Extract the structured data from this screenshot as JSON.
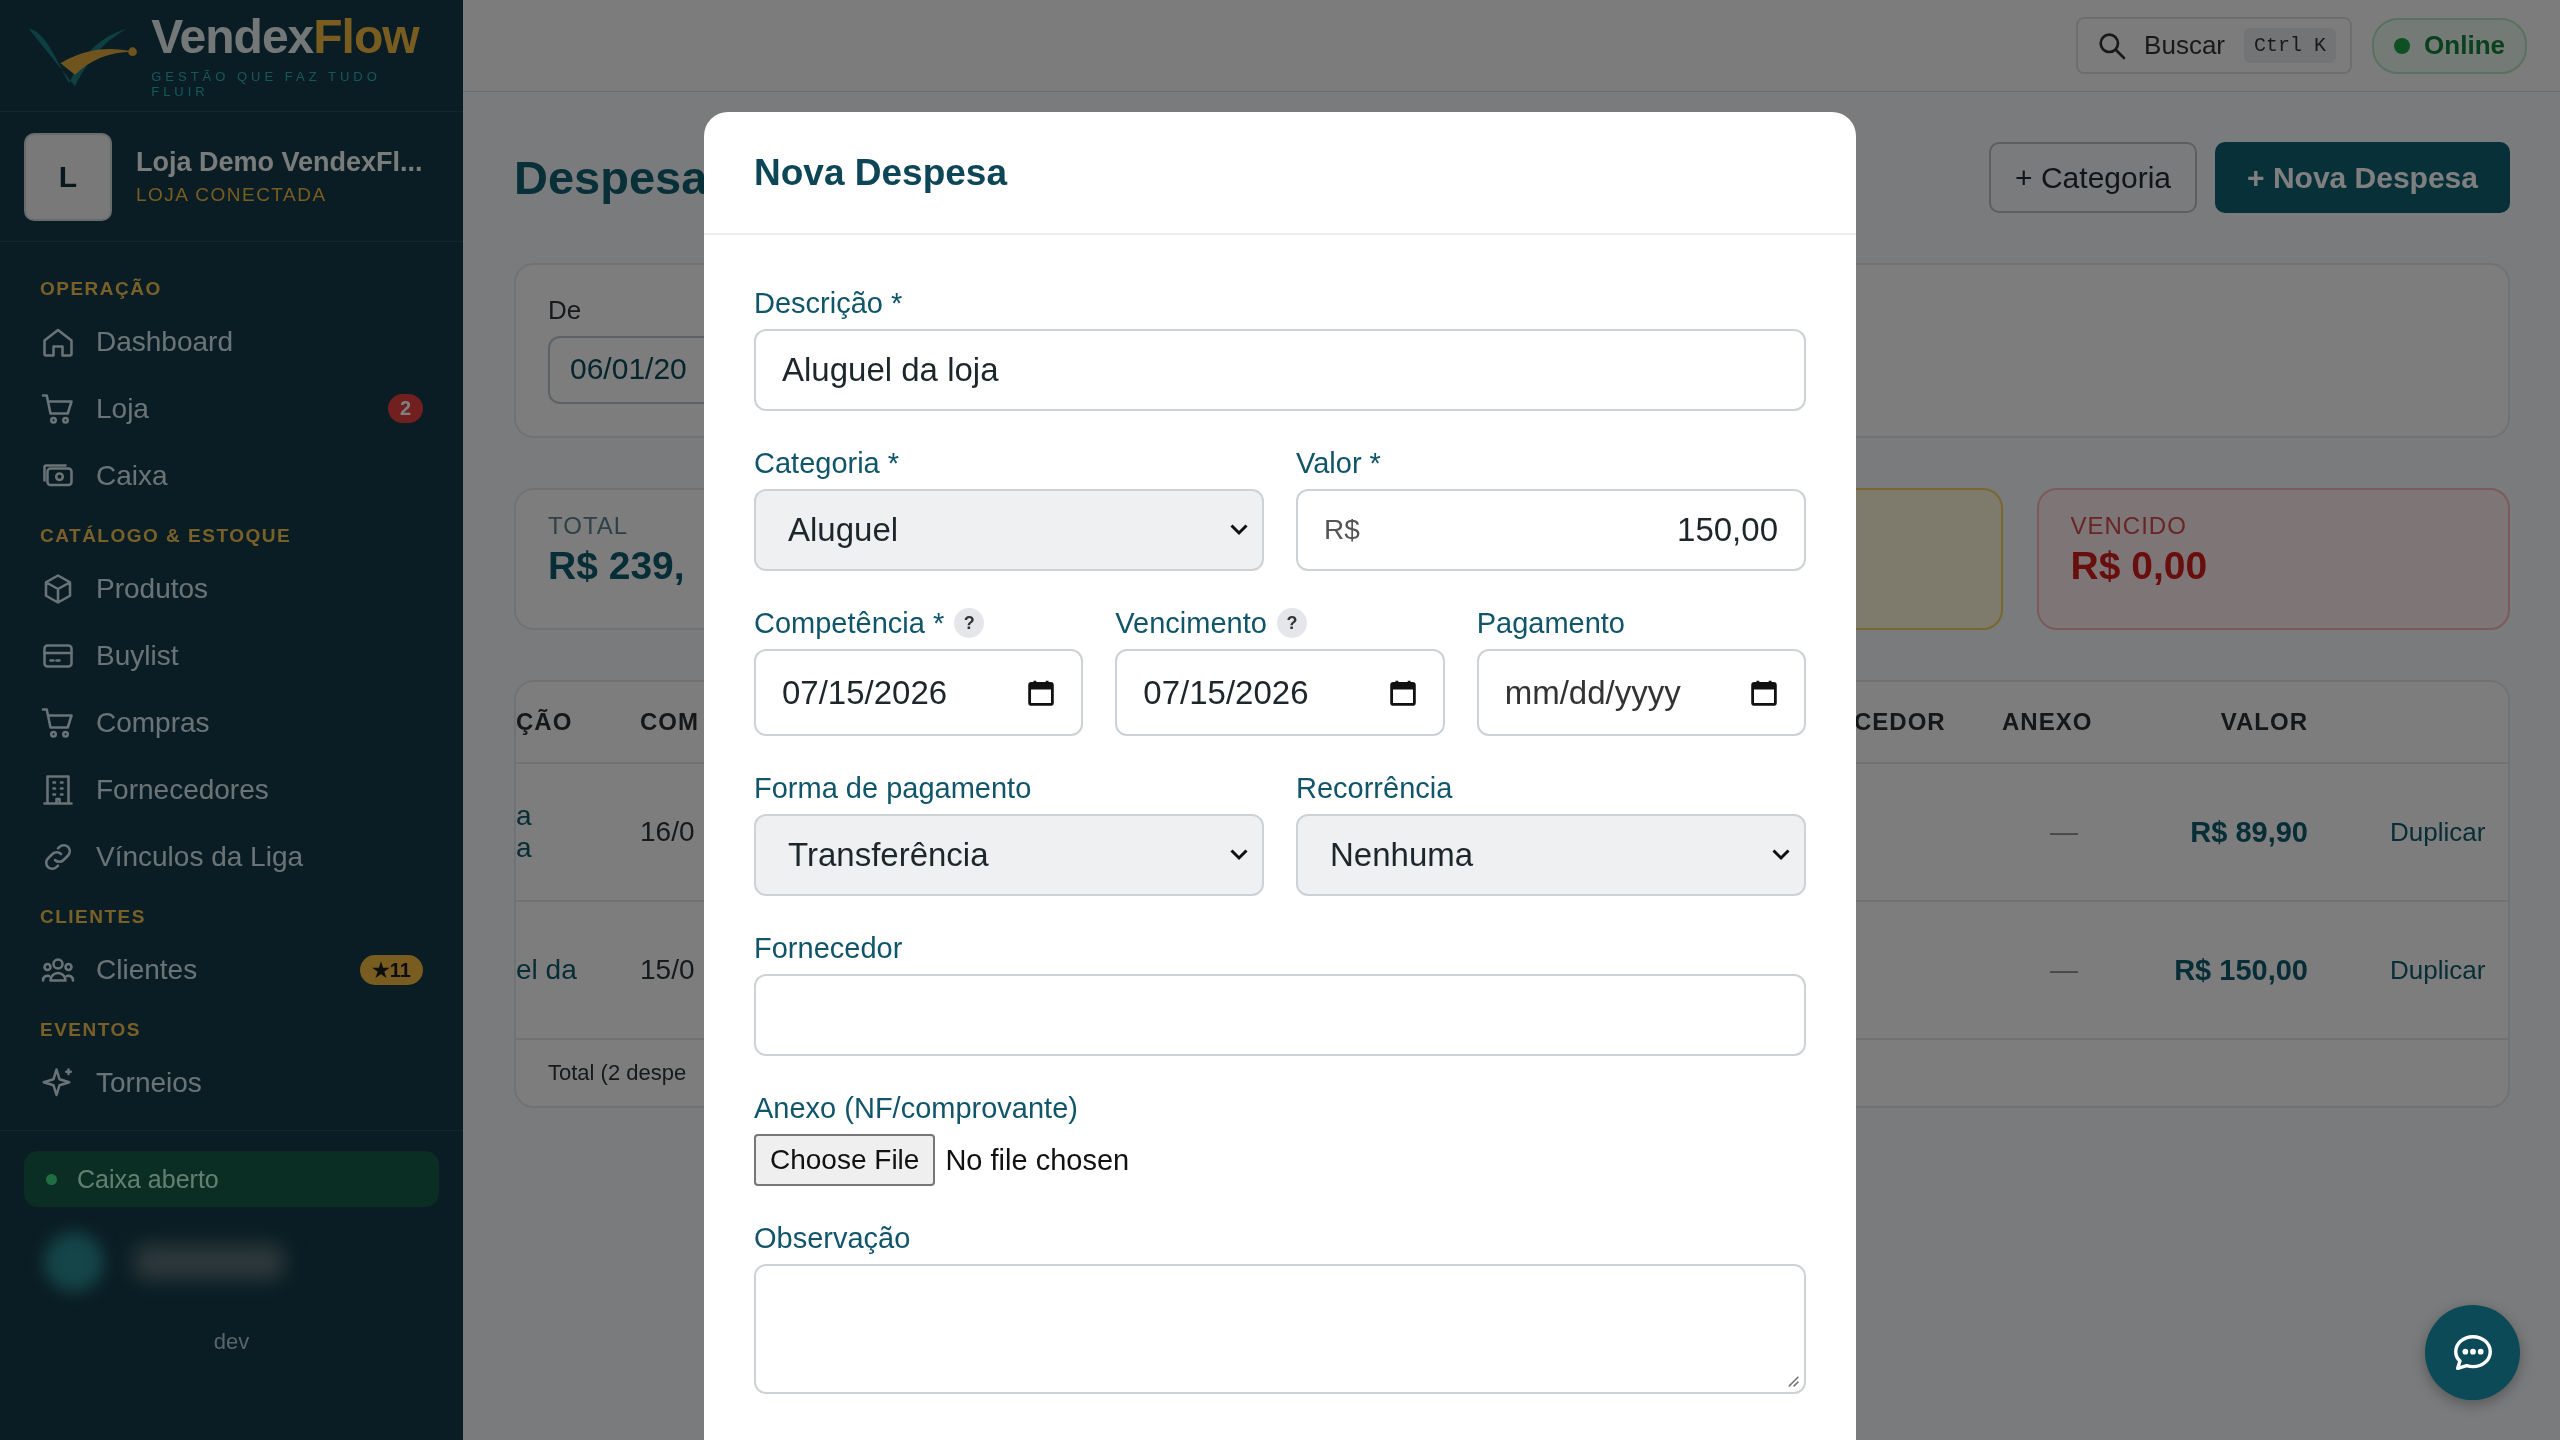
{
  "sidebar": {
    "brand": {
      "name": [
        "Vendex",
        "Flow"
      ],
      "tagline": "GESTÃO QUE FAZ TUDO FLUIR"
    },
    "store": {
      "initial": "L",
      "name": "Loja Demo VendexFl...",
      "status": "LOJA CONECTADA"
    },
    "sections": [
      {
        "title": "OPERAÇÃO",
        "items": [
          {
            "label": "Dashboard"
          },
          {
            "label": "Loja",
            "badge": "2",
            "kind": "alert"
          },
          {
            "label": "Caixa"
          }
        ]
      },
      {
        "title": "CATÁLOGO & ESTOQUE",
        "items": [
          {
            "label": "Produtos"
          },
          {
            "label": "Buylist"
          },
          {
            "label": "Compras"
          },
          {
            "label": "Fornecedores"
          },
          {
            "label": "Vínculos da Liga"
          }
        ]
      },
      {
        "title": "CLIENTES",
        "items": [
          {
            "label": "Clientes",
            "badge": "★11",
            "kind": "highlight"
          }
        ]
      },
      {
        "title": "EVENTOS",
        "items": [
          {
            "label": "Torneios"
          }
        ]
      }
    ],
    "cash_status": "Caixa aberto",
    "footer": "dev"
  },
  "topbar": {
    "search": {
      "placeholder": "Buscar",
      "shortcut": "Ctrl K"
    },
    "status": "Online"
  },
  "page": {
    "title": "Despesa",
    "actions": [
      {
        "label": "+ Categoria",
        "kind": "secondary"
      },
      {
        "label": "+ Nova Despesa",
        "kind": "primary"
      }
    ],
    "filter": {
      "label": "De",
      "value": "06/01/20"
    },
    "stats": [
      {
        "label": "TOTAL",
        "value": "R$ 239,",
        "kind": "neutral"
      },
      {
        "kind": "warning"
      },
      {
        "label": "VENCIDO",
        "value": "R$ 0,00",
        "kind": "danger"
      }
    ],
    "table": {
      "columns": [
        "ÇÃO",
        "COM",
        "CEDOR",
        "ANEXO",
        "VALOR"
      ],
      "rows": [
        {
          "description": "a\na",
          "date": "16/0",
          "attachment": "—",
          "value": "R$ 89,90",
          "action": "Duplicar"
        },
        {
          "description": "el da",
          "date": "15/0",
          "attachment": "—",
          "value": "R$ 150,00",
          "action": "Duplicar"
        }
      ],
      "footer": "Total (2 despe"
    }
  },
  "modal": {
    "title": "Nova Despesa",
    "rows": [
      [
        {
          "label": "Descrição *",
          "kind": "text",
          "value": "Aluguel da loja"
        }
      ],
      [
        {
          "label": "Categoria *",
          "kind": "select",
          "value": "Aluguel"
        },
        {
          "label": "Valor *",
          "kind": "money",
          "prefix": "R$",
          "value": "150,00"
        }
      ],
      [
        {
          "label": "Competência *",
          "hint": "?",
          "kind": "date",
          "value": "07/15/2026"
        },
        {
          "label": "Vencimento",
          "hint": "?",
          "kind": "date",
          "value": "07/15/2026"
        },
        {
          "label": "Pagamento",
          "kind": "date",
          "placeholder": "mm/dd/yyyy"
        }
      ],
      [
        {
          "label": "Forma de pagamento",
          "kind": "select",
          "value": "Transferência"
        },
        {
          "label": "Recorrência",
          "kind": "select",
          "value": "Nenhuma"
        }
      ],
      [
        {
          "label": "Fornecedor",
          "kind": "text"
        }
      ],
      [
        {
          "label": "Anexo (NF/comprovante)",
          "kind": "file",
          "button": "Choose File",
          "status": "No file chosen"
        }
      ],
      [
        {
          "label": "Observação",
          "kind": "textarea"
        }
      ]
    ]
  }
}
